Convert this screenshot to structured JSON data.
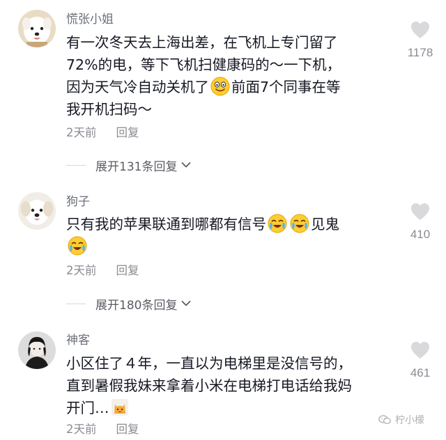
{
  "comments": [
    {
      "username": "慌张小姐",
      "text_lines": [
        "有一次冬天去上海出差，在飞机上专门留了",
        "72%的电，等下飞机扫健康码的～一下机，",
        "因为天气冷自动关机了",
        "前面7个同事在等",
        "我开机扫码～"
      ],
      "time": "2天前",
      "reply": "回复",
      "likes": "1178",
      "expand": "展开131条回复",
      "avatar_icon": "white-dog-avatar-icon"
    },
    {
      "username": "狗子",
      "text_lines": [
        "只有我的苹果联通到哪都有信号",
        "见鬼"
      ],
      "time": "2天前",
      "reply": "回复",
      "likes": "410",
      "expand": "展开180条回复",
      "avatar_icon": "puppy-avatar-icon"
    },
    {
      "username": "神客",
      "text_lines": [
        "小区住了４年，一直以为电梯里是没信号的，",
        "直到暑假我妹来拿着小米在电梯打电话给我妈",
        "开门…"
      ],
      "time": "2天前",
      "reply": "回复",
      "likes": "461",
      "avatar_icon": "anime-character-avatar-icon"
    }
  ],
  "watermark": "柠小檬",
  "colors": {
    "text": "#161823",
    "secondary": "#8a8b91",
    "heart": "#d9d9dc"
  }
}
